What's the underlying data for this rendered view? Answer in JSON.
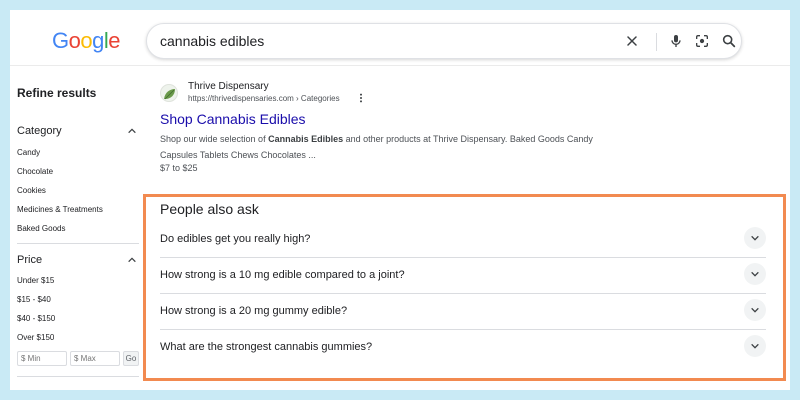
{
  "logo": {
    "letters": [
      "G",
      "o",
      "o",
      "g",
      "l",
      "e"
    ],
    "colors": [
      "#4285F4",
      "#EA4335",
      "#FBBC05",
      "#4285F4",
      "#34A853",
      "#EA4335"
    ]
  },
  "search": {
    "query": "cannabis edibles"
  },
  "icons": {
    "clear": "close-icon",
    "voice": "microphone-icon",
    "lens": "camera-lens-icon",
    "search": "search-icon"
  },
  "sidebar": {
    "title": "Refine results",
    "category": {
      "label": "Category",
      "items": [
        "Candy",
        "Chocolate",
        "Cookies",
        "Medicines & Treatments",
        "Baked Goods"
      ]
    },
    "price": {
      "label": "Price",
      "items": [
        "Under $15",
        "$15 - $40",
        "$40 - $150",
        "Over $150"
      ],
      "min_placeholder": "$ Min",
      "max_placeholder": "$ Max",
      "go_label": "Go"
    }
  },
  "result": {
    "site_name": "Thrive Dispensary",
    "url": "https://thrivedispensaries.com › Categories",
    "title": "Shop Cannabis Edibles",
    "snippet_pre": "Shop our wide selection of ",
    "snippet_bold": "Cannabis Edibles",
    "snippet_post": " and other products at Thrive Dispensary. Baked Goods Candy Capsules Tablets Chews Chocolates ...",
    "price_range": "$7 to $25"
  },
  "paa": {
    "title": "People also ask",
    "questions": [
      "Do edibles get you really high?",
      "How strong is a 10 mg edible compared to a joint?",
      "How strong is a 20 mg gummy edible?",
      "What are the strongest cannabis gummies?"
    ]
  },
  "colors": {
    "highlight": "#f28a50",
    "link": "#1a0dab",
    "background": "#c9eaf5"
  }
}
